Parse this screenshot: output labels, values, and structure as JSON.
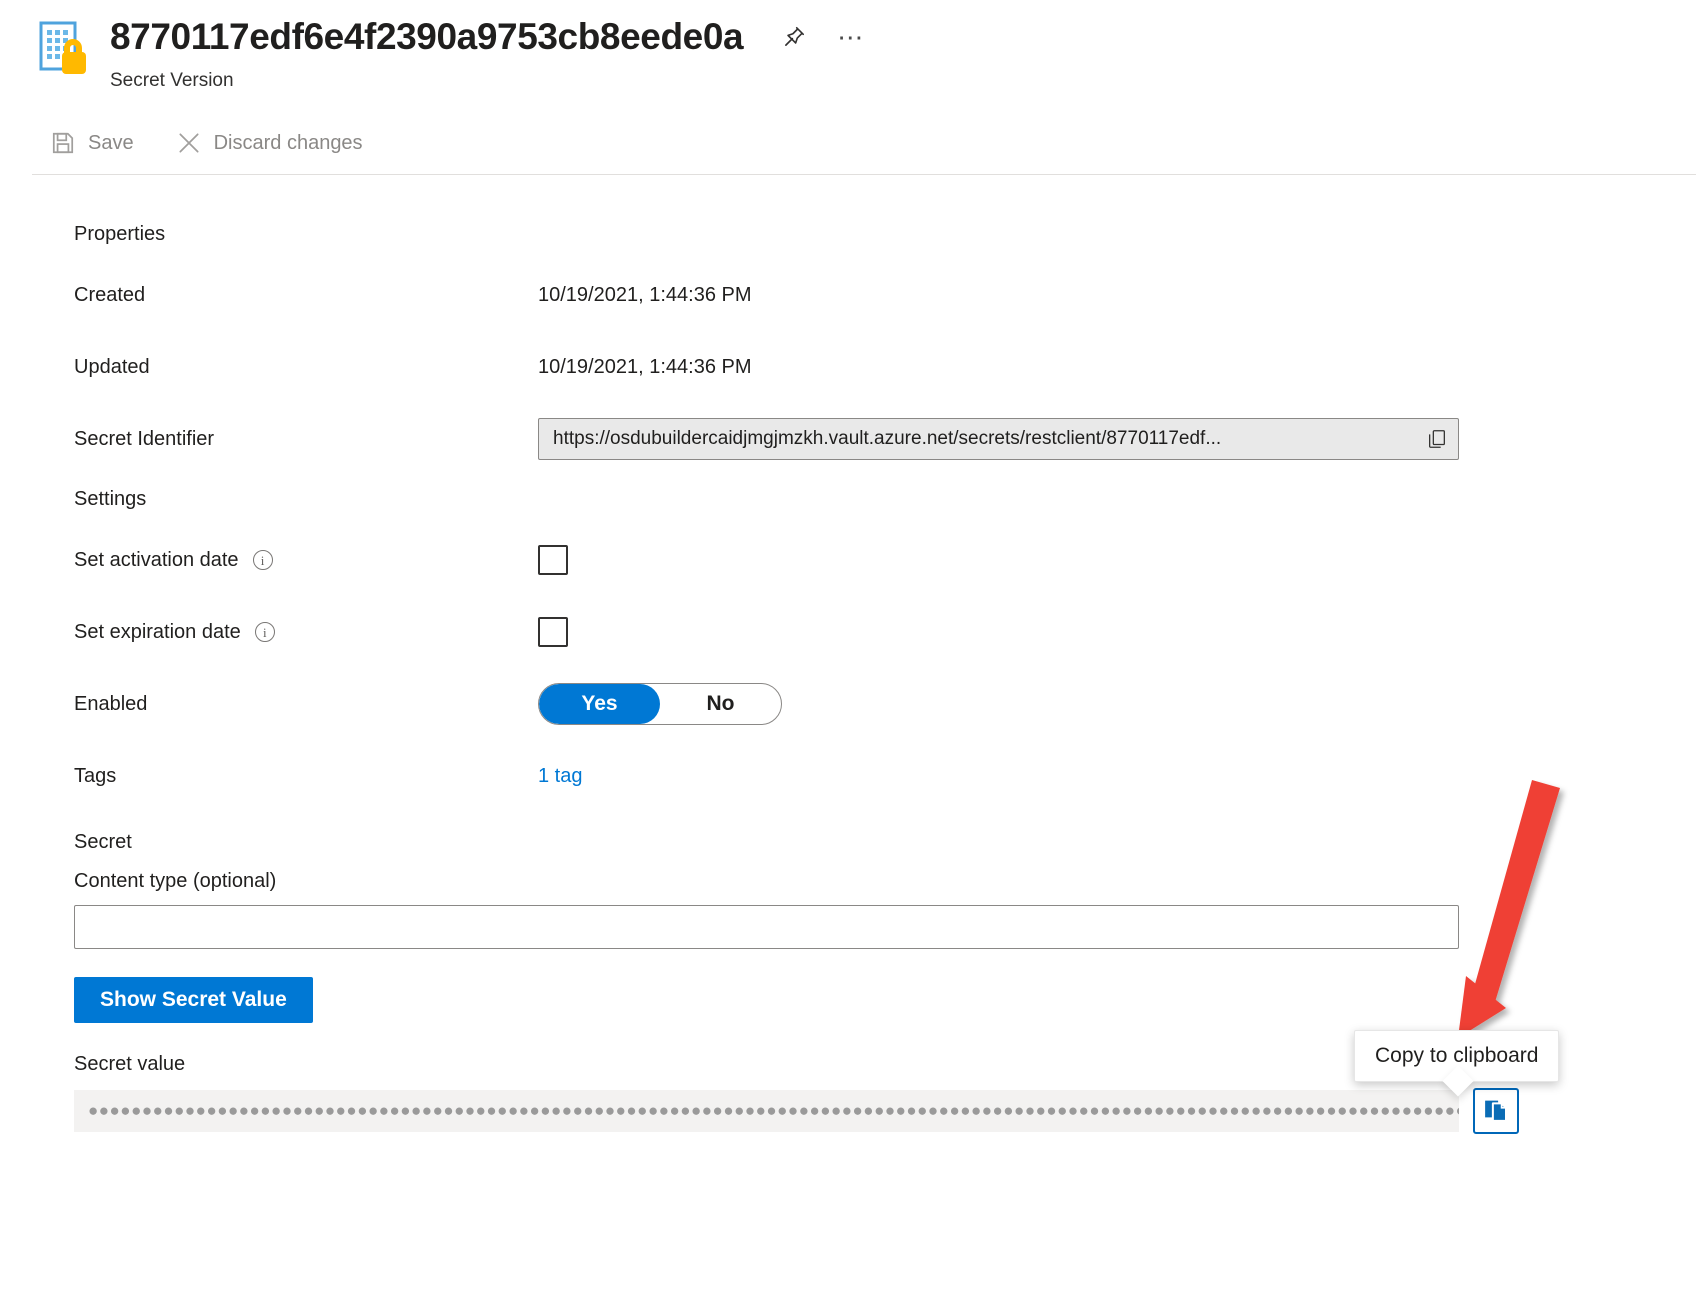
{
  "header": {
    "title": "8770117edf6e4f2390a9753cb8eede0a",
    "subtitle": "Secret Version",
    "resource_icon": "secret-version-icon",
    "pin_icon": "pin-icon",
    "more_icon": "ellipsis-icon"
  },
  "commandbar": {
    "save": {
      "label": "Save",
      "icon": "save-icon"
    },
    "discard": {
      "label": "Discard changes",
      "icon": "close-x-icon"
    }
  },
  "properties": {
    "heading": "Properties",
    "created": {
      "label": "Created",
      "value": "10/19/2021, 1:44:36 PM"
    },
    "updated": {
      "label": "Updated",
      "value": "10/19/2021, 1:44:36 PM"
    },
    "secret_identifier": {
      "label": "Secret Identifier",
      "value": "https://osdubuildercaidjmgjmzkh.vault.azure.net/secrets/restclient/8770117edf...",
      "copy_icon": "copy-icon"
    }
  },
  "settings": {
    "heading": "Settings",
    "set_activation_date": {
      "label": "Set activation date",
      "info_icon": "info-icon",
      "checked": false
    },
    "set_expiration_date": {
      "label": "Set expiration date",
      "info_icon": "info-icon",
      "checked": false
    },
    "enabled": {
      "label": "Enabled",
      "yes": "Yes",
      "no": "No",
      "selected": "Yes"
    },
    "tags": {
      "label": "Tags",
      "value": "1 tag"
    }
  },
  "secret": {
    "heading": "Secret",
    "content_type": {
      "label": "Content type (optional)",
      "value": "",
      "placeholder": ""
    },
    "show_button": "Show Secret Value",
    "secret_value": {
      "label": "Secret value",
      "masked": "●●●●●●●●●●●●●●●●●●●●●●●●●●●●●●●●●●●●●●●●●●●●●●●●●●●●●●●●●●●●●●●●●●●●●●●●●●●●●●●●●●●●●●●●●●●●●●●●●●●●●●●●●●●●●●●●●●●●●●●●●●●●●●●●●●●●●●●●●●●●●●●●●●●●● ···",
      "copy_icon": "copy-icon"
    }
  },
  "tooltip": {
    "text": "Copy to clipboard"
  },
  "annotation": {
    "arrow_color": "#ef4136",
    "type": "arrow-pointer"
  },
  "colors": {
    "accent": "#0078d4",
    "link": "#0078d4",
    "disabled_text": "#8a8886",
    "annotation_red": "#ef4136",
    "icon_blue": "#4fa3dd",
    "icon_yellow": "#ffb900"
  }
}
